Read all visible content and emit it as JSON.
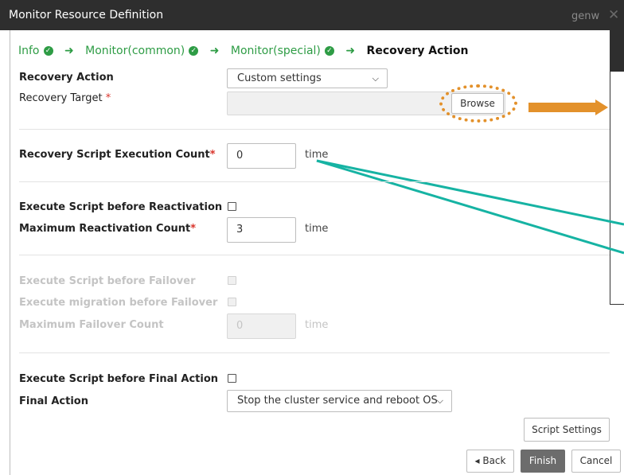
{
  "window": {
    "title": "Monitor Resource Definition",
    "user": "genw",
    "close_glyph": "✕"
  },
  "steps": [
    {
      "label": "Info",
      "done": true
    },
    {
      "label": "Monitor(common)",
      "done": true
    },
    {
      "label": "Monitor(special)",
      "done": true
    },
    {
      "label": "Recovery Action",
      "current": true
    }
  ],
  "step_icons": {
    "check": "✓",
    "arrow": "➜"
  },
  "form": {
    "recovery_action": {
      "label": "Recovery Action",
      "value": "Custom settings"
    },
    "recovery_target": {
      "label": "Recovery Target",
      "required_mark": "*",
      "value": "",
      "browse_label": "Browse"
    },
    "script_count": {
      "label": "Recovery Script Execution Count",
      "required_mark": "*",
      "value": "0",
      "unit": "time"
    },
    "exec_before_reactivation": {
      "label": "Execute Script before Reactivation",
      "checked": false
    },
    "max_reactivation": {
      "label": "Maximum Reactivation Count",
      "required_mark": "*",
      "value": "3",
      "unit": "time"
    },
    "exec_before_failover": {
      "label": "Execute Script before Failover",
      "checked": false,
      "disabled": true
    },
    "exec_migration_before_failover": {
      "label": "Execute migration before Failover",
      "checked": false,
      "disabled": true
    },
    "max_failover": {
      "label": "Maximum Failover Count",
      "value": "0",
      "unit": "time",
      "disabled": true
    },
    "exec_before_final": {
      "label": "Execute Script before Final Action",
      "checked": false
    },
    "final_action": {
      "label": "Final Action",
      "value": "Stop the cluster service and reboot OS"
    }
  },
  "buttons": {
    "script_settings": "Script Settings",
    "back": "◂ Back",
    "finish": "Finish",
    "cancel": "Cancel"
  },
  "annotation_colors": {
    "orange": "#e3912b",
    "teal": "#16b3a3",
    "green": "#2e9c45"
  }
}
